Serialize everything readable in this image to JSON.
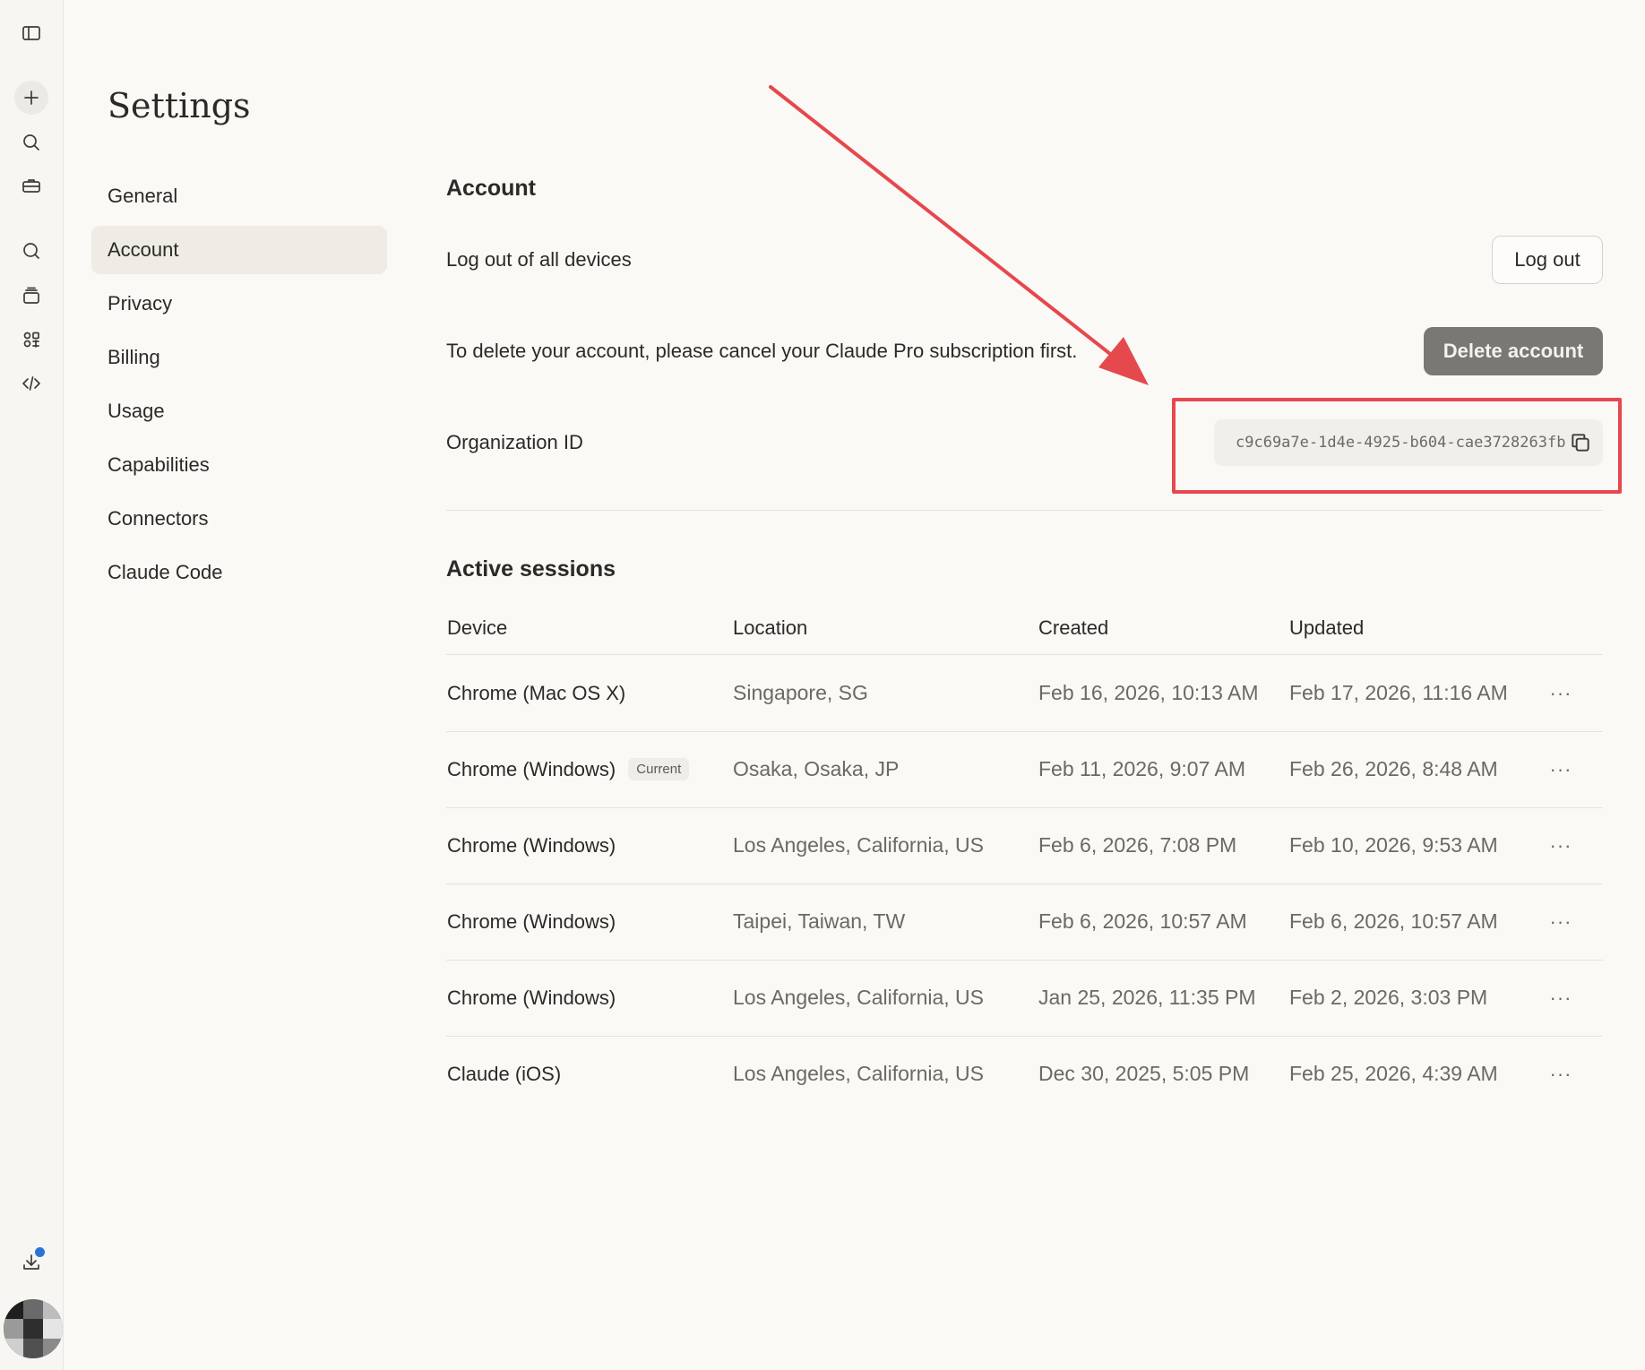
{
  "settings_title": "Settings",
  "nav": [
    {
      "label": "General"
    },
    {
      "label": "Account"
    },
    {
      "label": "Privacy"
    },
    {
      "label": "Billing"
    },
    {
      "label": "Usage"
    },
    {
      "label": "Capabilities"
    },
    {
      "label": "Connectors"
    },
    {
      "label": "Claude Code"
    }
  ],
  "nav_active": "Account",
  "account": {
    "title": "Account",
    "logout_all_label": "Log out of all devices",
    "logout_button": "Log out",
    "delete_note": "To delete your account, please cancel your Claude Pro subscription first.",
    "delete_button": "Delete account",
    "org_id_label": "Organization ID",
    "org_id_value": "c9c69a7e-1d4e-4925-b604-cae3728263fb"
  },
  "sessions": {
    "title": "Active sessions",
    "columns": [
      "Device",
      "Location",
      "Created",
      "Updated"
    ],
    "rows": [
      {
        "device": "Chrome (Mac OS X)",
        "badge": "",
        "location": "Singapore, SG",
        "created": "Feb 16, 2026, 10:13 AM",
        "updated": "Feb 17, 2026, 11:16 AM"
      },
      {
        "device": "Chrome (Windows)",
        "badge": "Current",
        "location": "Osaka, Osaka, JP",
        "created": "Feb 11, 2026, 9:07 AM",
        "updated": "Feb 26, 2026, 8:48 AM"
      },
      {
        "device": "Chrome (Windows)",
        "badge": "",
        "location": "Los Angeles, California, US",
        "created": "Feb 6, 2026, 7:08 PM",
        "updated": "Feb 10, 2026, 9:53 AM"
      },
      {
        "device": "Chrome (Windows)",
        "badge": "",
        "location": "Taipei, Taiwan, TW",
        "created": "Feb 6, 2026, 10:57 AM",
        "updated": "Feb 6, 2026, 10:57 AM"
      },
      {
        "device": "Chrome (Windows)",
        "badge": "",
        "location": "Los Angeles, California, US",
        "created": "Jan 25, 2026, 11:35 PM",
        "updated": "Feb 2, 2026, 3:03 PM"
      },
      {
        "device": "Claude (iOS)",
        "badge": "",
        "location": "Los Angeles, California, US",
        "created": "Dec 30, 2025, 5:05 PM",
        "updated": "Feb 25, 2026, 4:39 AM"
      }
    ],
    "more_glyph": "···"
  },
  "colors": {
    "background": "#faf9f6",
    "annotation_red": "#e5484d",
    "delete_button": "#7a7874",
    "notification_dot": "#2b74d6"
  },
  "rail_icons": [
    "sidebar-toggle-icon",
    "plus-icon",
    "search-icon",
    "briefcase-icon",
    "chat-icon",
    "projects-icon",
    "artifacts-icon",
    "code-icon",
    "download-icon"
  ]
}
